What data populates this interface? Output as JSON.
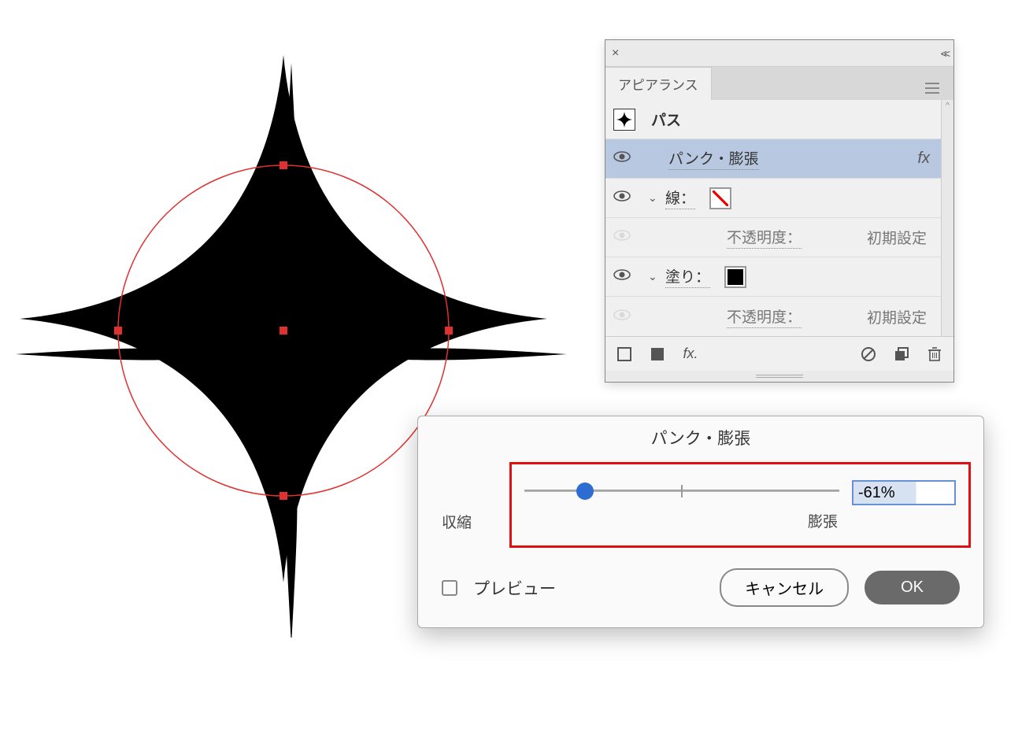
{
  "appearance": {
    "tab": "アピアランス",
    "path_label": "パス",
    "effect_row": "パンク・膨張",
    "fx": "fx",
    "stroke_label": "線：",
    "opacity_label": "不透明度：",
    "opacity_value": "初期設定",
    "fill_label": "塗り："
  },
  "dialog": {
    "title": "パンク・膨張",
    "shrink_label": "収縮",
    "expand_label": "膨張",
    "value": "-61%",
    "preview": "プレビュー",
    "cancel": "キャンセル",
    "ok": "OK"
  }
}
